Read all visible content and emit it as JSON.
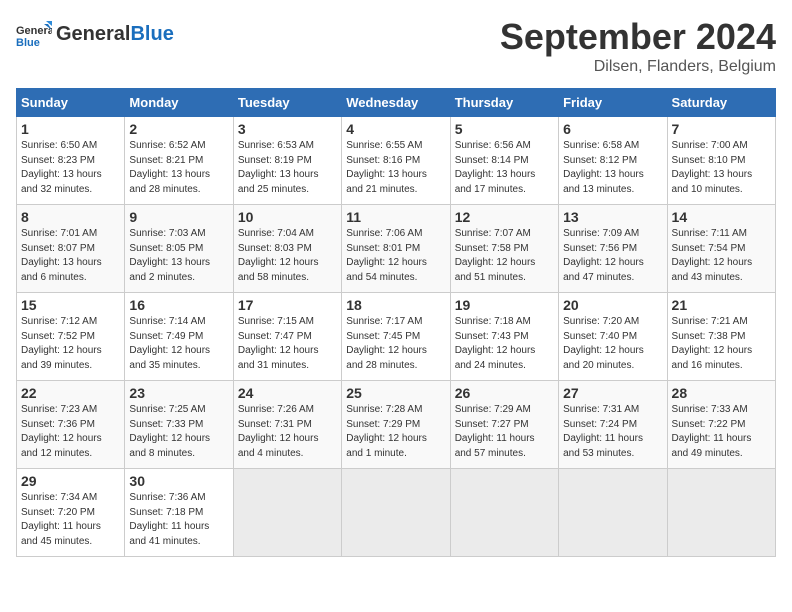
{
  "header": {
    "logo_line1": "General",
    "logo_line2": "Blue",
    "month": "September 2024",
    "location": "Dilsen, Flanders, Belgium"
  },
  "weekdays": [
    "Sunday",
    "Monday",
    "Tuesday",
    "Wednesday",
    "Thursday",
    "Friday",
    "Saturday"
  ],
  "weeks": [
    [
      {
        "day": 1,
        "info": "Sunrise: 6:50 AM\nSunset: 8:23 PM\nDaylight: 13 hours\nand 32 minutes."
      },
      {
        "day": 2,
        "info": "Sunrise: 6:52 AM\nSunset: 8:21 PM\nDaylight: 13 hours\nand 28 minutes."
      },
      {
        "day": 3,
        "info": "Sunrise: 6:53 AM\nSunset: 8:19 PM\nDaylight: 13 hours\nand 25 minutes."
      },
      {
        "day": 4,
        "info": "Sunrise: 6:55 AM\nSunset: 8:16 PM\nDaylight: 13 hours\nand 21 minutes."
      },
      {
        "day": 5,
        "info": "Sunrise: 6:56 AM\nSunset: 8:14 PM\nDaylight: 13 hours\nand 17 minutes."
      },
      {
        "day": 6,
        "info": "Sunrise: 6:58 AM\nSunset: 8:12 PM\nDaylight: 13 hours\nand 13 minutes."
      },
      {
        "day": 7,
        "info": "Sunrise: 7:00 AM\nSunset: 8:10 PM\nDaylight: 13 hours\nand 10 minutes."
      }
    ],
    [
      {
        "day": 8,
        "info": "Sunrise: 7:01 AM\nSunset: 8:07 PM\nDaylight: 13 hours\nand 6 minutes."
      },
      {
        "day": 9,
        "info": "Sunrise: 7:03 AM\nSunset: 8:05 PM\nDaylight: 13 hours\nand 2 minutes."
      },
      {
        "day": 10,
        "info": "Sunrise: 7:04 AM\nSunset: 8:03 PM\nDaylight: 12 hours\nand 58 minutes."
      },
      {
        "day": 11,
        "info": "Sunrise: 7:06 AM\nSunset: 8:01 PM\nDaylight: 12 hours\nand 54 minutes."
      },
      {
        "day": 12,
        "info": "Sunrise: 7:07 AM\nSunset: 7:58 PM\nDaylight: 12 hours\nand 51 minutes."
      },
      {
        "day": 13,
        "info": "Sunrise: 7:09 AM\nSunset: 7:56 PM\nDaylight: 12 hours\nand 47 minutes."
      },
      {
        "day": 14,
        "info": "Sunrise: 7:11 AM\nSunset: 7:54 PM\nDaylight: 12 hours\nand 43 minutes."
      }
    ],
    [
      {
        "day": 15,
        "info": "Sunrise: 7:12 AM\nSunset: 7:52 PM\nDaylight: 12 hours\nand 39 minutes."
      },
      {
        "day": 16,
        "info": "Sunrise: 7:14 AM\nSunset: 7:49 PM\nDaylight: 12 hours\nand 35 minutes."
      },
      {
        "day": 17,
        "info": "Sunrise: 7:15 AM\nSunset: 7:47 PM\nDaylight: 12 hours\nand 31 minutes."
      },
      {
        "day": 18,
        "info": "Sunrise: 7:17 AM\nSunset: 7:45 PM\nDaylight: 12 hours\nand 28 minutes."
      },
      {
        "day": 19,
        "info": "Sunrise: 7:18 AM\nSunset: 7:43 PM\nDaylight: 12 hours\nand 24 minutes."
      },
      {
        "day": 20,
        "info": "Sunrise: 7:20 AM\nSunset: 7:40 PM\nDaylight: 12 hours\nand 20 minutes."
      },
      {
        "day": 21,
        "info": "Sunrise: 7:21 AM\nSunset: 7:38 PM\nDaylight: 12 hours\nand 16 minutes."
      }
    ],
    [
      {
        "day": 22,
        "info": "Sunrise: 7:23 AM\nSunset: 7:36 PM\nDaylight: 12 hours\nand 12 minutes."
      },
      {
        "day": 23,
        "info": "Sunrise: 7:25 AM\nSunset: 7:33 PM\nDaylight: 12 hours\nand 8 minutes."
      },
      {
        "day": 24,
        "info": "Sunrise: 7:26 AM\nSunset: 7:31 PM\nDaylight: 12 hours\nand 4 minutes."
      },
      {
        "day": 25,
        "info": "Sunrise: 7:28 AM\nSunset: 7:29 PM\nDaylight: 12 hours\nand 1 minute."
      },
      {
        "day": 26,
        "info": "Sunrise: 7:29 AM\nSunset: 7:27 PM\nDaylight: 11 hours\nand 57 minutes."
      },
      {
        "day": 27,
        "info": "Sunrise: 7:31 AM\nSunset: 7:24 PM\nDaylight: 11 hours\nand 53 minutes."
      },
      {
        "day": 28,
        "info": "Sunrise: 7:33 AM\nSunset: 7:22 PM\nDaylight: 11 hours\nand 49 minutes."
      }
    ],
    [
      {
        "day": 29,
        "info": "Sunrise: 7:34 AM\nSunset: 7:20 PM\nDaylight: 11 hours\nand 45 minutes."
      },
      {
        "day": 30,
        "info": "Sunrise: 7:36 AM\nSunset: 7:18 PM\nDaylight: 11 hours\nand 41 minutes."
      },
      null,
      null,
      null,
      null,
      null
    ]
  ]
}
